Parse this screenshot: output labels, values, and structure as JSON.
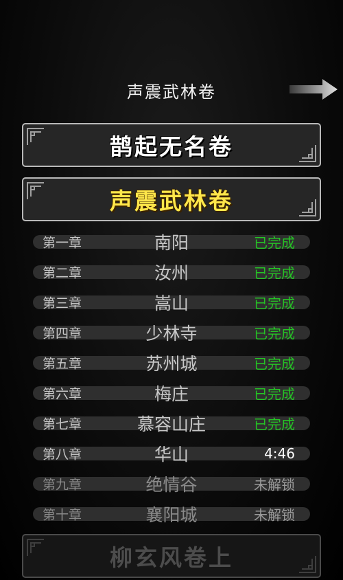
{
  "header": {
    "title": "声震武林卷",
    "next_icon": "right-arrow-icon"
  },
  "volumes": {
    "vol1": {
      "label": "鹊起无名卷"
    },
    "vol2": {
      "label": "声震武林卷"
    },
    "vol3": {
      "label": "柳玄风卷上"
    }
  },
  "colors": {
    "completed": "#25c425",
    "timer": "#ffffff",
    "locked": "#9a9a9a",
    "selected_volume": "#ffe64a"
  },
  "chapters": [
    {
      "number": "第一章",
      "name": "南阳",
      "status": "已完成",
      "state": "completed"
    },
    {
      "number": "第二章",
      "name": "汝州",
      "status": "已完成",
      "state": "completed"
    },
    {
      "number": "第三章",
      "name": "嵩山",
      "status": "已完成",
      "state": "completed"
    },
    {
      "number": "第四章",
      "name": "少林寺",
      "status": "已完成",
      "state": "completed"
    },
    {
      "number": "第五章",
      "name": "苏州城",
      "status": "已完成",
      "state": "completed"
    },
    {
      "number": "第六章",
      "name": "梅庄",
      "status": "已完成",
      "state": "completed"
    },
    {
      "number": "第七章",
      "name": "慕容山庄",
      "status": "已完成",
      "state": "completed"
    },
    {
      "number": "第八章",
      "name": "华山",
      "status": "4:46",
      "state": "timer"
    },
    {
      "number": "第九章",
      "name": "绝情谷",
      "status": "未解锁",
      "state": "locked"
    },
    {
      "number": "第十章",
      "name": "襄阳城",
      "status": "未解锁",
      "state": "locked"
    }
  ]
}
